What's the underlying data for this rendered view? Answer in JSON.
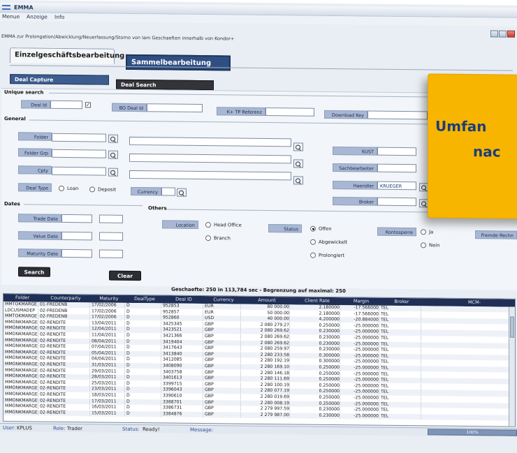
{
  "window": {
    "title": "EMMA"
  },
  "menu": {
    "items": [
      "Menue",
      "Anzeige",
      "Info"
    ]
  },
  "description": "EMMA zur Prolongation/Abwicklung/Neuerfassung/Storno von Iam Geschaeften innerhalb von Kondor+",
  "main_tabs": {
    "single": "Einzelgeschäftsbearbeitung",
    "bulk": "Sammelbearbeitung"
  },
  "sub_tabs": {
    "capture": "Deal Capture",
    "search": "Deal Search"
  },
  "unique_search": {
    "section": "Unique search",
    "deal_id": "Deal Id",
    "bo_deal_id": "BO Deal Id",
    "tp_ref": "K+ TP Referenz",
    "download_key": "Download Key"
  },
  "general": {
    "section": "General",
    "folder": "Folder",
    "folder_grp": "Folder Grp",
    "cpty": "Cpty",
    "deal_type": "Deal Type",
    "loan": "Loan",
    "deposit": "Deposit",
    "currency": "Currency",
    "kust": "KUST",
    "sachbearbeiter": "Sachbearbeiter",
    "haendler": "Haendler",
    "haendler_value": "KRUEGER",
    "broker": "Broker"
  },
  "dates": {
    "section": "Dates",
    "trade": "Trade Date",
    "value": "Value Date",
    "maturity": "Maturity Date"
  },
  "others": {
    "section": "Others",
    "location": "Location",
    "head_office": "Head Office",
    "branch": "Branch",
    "status": "Status",
    "offen": "Offen",
    "abgewickelt": "Abgewickelt",
    "prolongiert": "Prolongiert",
    "kontosperre": "Kontosperre",
    "ja": "Ja",
    "nein": "Nein",
    "fremde_rech": "Fremde Rechn"
  },
  "buttons": {
    "search": "Search",
    "clear": "Clear"
  },
  "callout": {
    "line1": "Umfan",
    "line2": "nac"
  },
  "grid": {
    "caption": "Geschaefte: 250 in 113,784 sec - Begrenzung auf maximal: 250",
    "columns": [
      "Folder",
      "Counterparty",
      "Maturity",
      "DealType",
      "Deal ID",
      "Currency",
      "Amount",
      "Client Rate",
      "Margin",
      "Broker",
      "MCM-"
    ],
    "rows": [
      [
        "MMTOKMARGE",
        "01-FREDENB",
        "17/02/2006",
        "D",
        "952853",
        "EUR",
        "80 000.00",
        "2.180000",
        "-17.566000",
        "TEL"
      ],
      [
        "LDCUSMADEP",
        "02-FREDENB",
        "17/02/2006",
        "D",
        "952857",
        "EUR",
        "50 000.00",
        "2.180000",
        "-17.566000",
        "TEL"
      ],
      [
        "MMTOKMARGE",
        "02-FREDENB",
        "17/02/2006",
        "D",
        "952860",
        "USD",
        "40 000.00",
        "4.200000",
        "-20.884000",
        "TEL"
      ],
      [
        "MMONKMARGE",
        "02-RENDITE",
        "13/04/2011",
        "D",
        "3425345",
        "GBP",
        "2 080 279.27",
        "0.250000",
        "-25.000000",
        "TEL"
      ],
      [
        "MMONKMARGE",
        "02-RENDITE",
        "12/04/2011",
        "D",
        "3423521",
        "GBP",
        "2 080 269.62",
        "0.230000",
        "-25.000000",
        "TEL"
      ],
      [
        "MMONKMARGE",
        "02-RENDITE",
        "11/04/2011",
        "D",
        "3421366",
        "GBP",
        "2 080 269.62",
        "0.230000",
        "-25.000000",
        "TEL"
      ],
      [
        "MMONKMARGE",
        "02-RENDITE",
        "08/04/2011",
        "D",
        "3419404",
        "GBP",
        "2 080 269.62",
        "0.230000",
        "-25.000000",
        "TEL"
      ],
      [
        "MMONKMARGE",
        "02-RENDITE",
        "07/04/2011",
        "D",
        "3417643",
        "GBP",
        "2 080 259.97",
        "0.230000",
        "-25.000000",
        "TEL"
      ],
      [
        "MMONKMARGE",
        "02-RENDITE",
        "05/04/2011",
        "D",
        "3413840",
        "GBP",
        "2 280 233.58",
        "0.300000",
        "-25.000000",
        "TEL"
      ],
      [
        "MMONKMARGE",
        "02-RENDITE",
        "04/04/2011",
        "D",
        "3412085",
        "GBP",
        "2 280 192.19",
        "0.300000",
        "-25.000000",
        "TEL"
      ],
      [
        "MMONKMARGE",
        "02-RENDITE",
        "31/03/2011",
        "D",
        "3408090",
        "GBP",
        "2 280 169.10",
        "0.250000",
        "-25.000000",
        "TEL"
      ],
      [
        "MMONKMARGE",
        "02-RENDITE",
        "29/03/2011",
        "D",
        "3403758",
        "GBP",
        "2 280 146.18",
        "0.250000",
        "-25.000000",
        "TEL"
      ],
      [
        "MMONKMARGE",
        "02-RENDITE",
        "28/03/2011",
        "D",
        "3401613",
        "GBP",
        "2 280 111.69",
        "0.250000",
        "-25.000000",
        "TEL"
      ],
      [
        "MMONKMARGE",
        "02-RENDITE",
        "25/03/2011",
        "D",
        "3399715",
        "GBP",
        "2 280 100.19",
        "0.250000",
        "-25.000000",
        "TEL"
      ],
      [
        "MMONKMARGE",
        "02-RENDITE",
        "23/03/2011",
        "D",
        "3396043",
        "GBP",
        "2 280 077.19",
        "0.250000",
        "-25.000000",
        "TEL"
      ],
      [
        "MMONKMARGE",
        "02-RENDITE",
        "18/03/2011",
        "D",
        "3390610",
        "GBP",
        "2 280 019.69",
        "0.250000",
        "-25.000000",
        "TEL"
      ],
      [
        "MMONKMARGE",
        "02-RENDITE",
        "17/03/2011",
        "D",
        "3388701",
        "GBP",
        "2 280 008.19",
        "0.250000",
        "-25.000000",
        "TEL"
      ],
      [
        "MMONKMARGE",
        "02-RENDITE",
        "16/03/2011",
        "D",
        "3386731",
        "GBP",
        "2 279 997.59",
        "0.230000",
        "-25.000000",
        "TEL"
      ],
      [
        "MMONKMARGE",
        "02-RENDITE",
        "15/03/2011",
        "D",
        "3384876",
        "GBP",
        "2 279 987.00",
        "0.230000",
        "-25.000000",
        "TEL"
      ]
    ]
  },
  "status": {
    "user_label": "User:",
    "user": "KPLUS",
    "role_label": "Role:",
    "role": "Trader",
    "status_label": "Status:",
    "status": "Ready!",
    "message_label": "Message:",
    "progress": "100%"
  },
  "colors": {
    "accent": "#2f4f82",
    "callout": "#f7b500",
    "grid_header": "#1f2f55"
  }
}
